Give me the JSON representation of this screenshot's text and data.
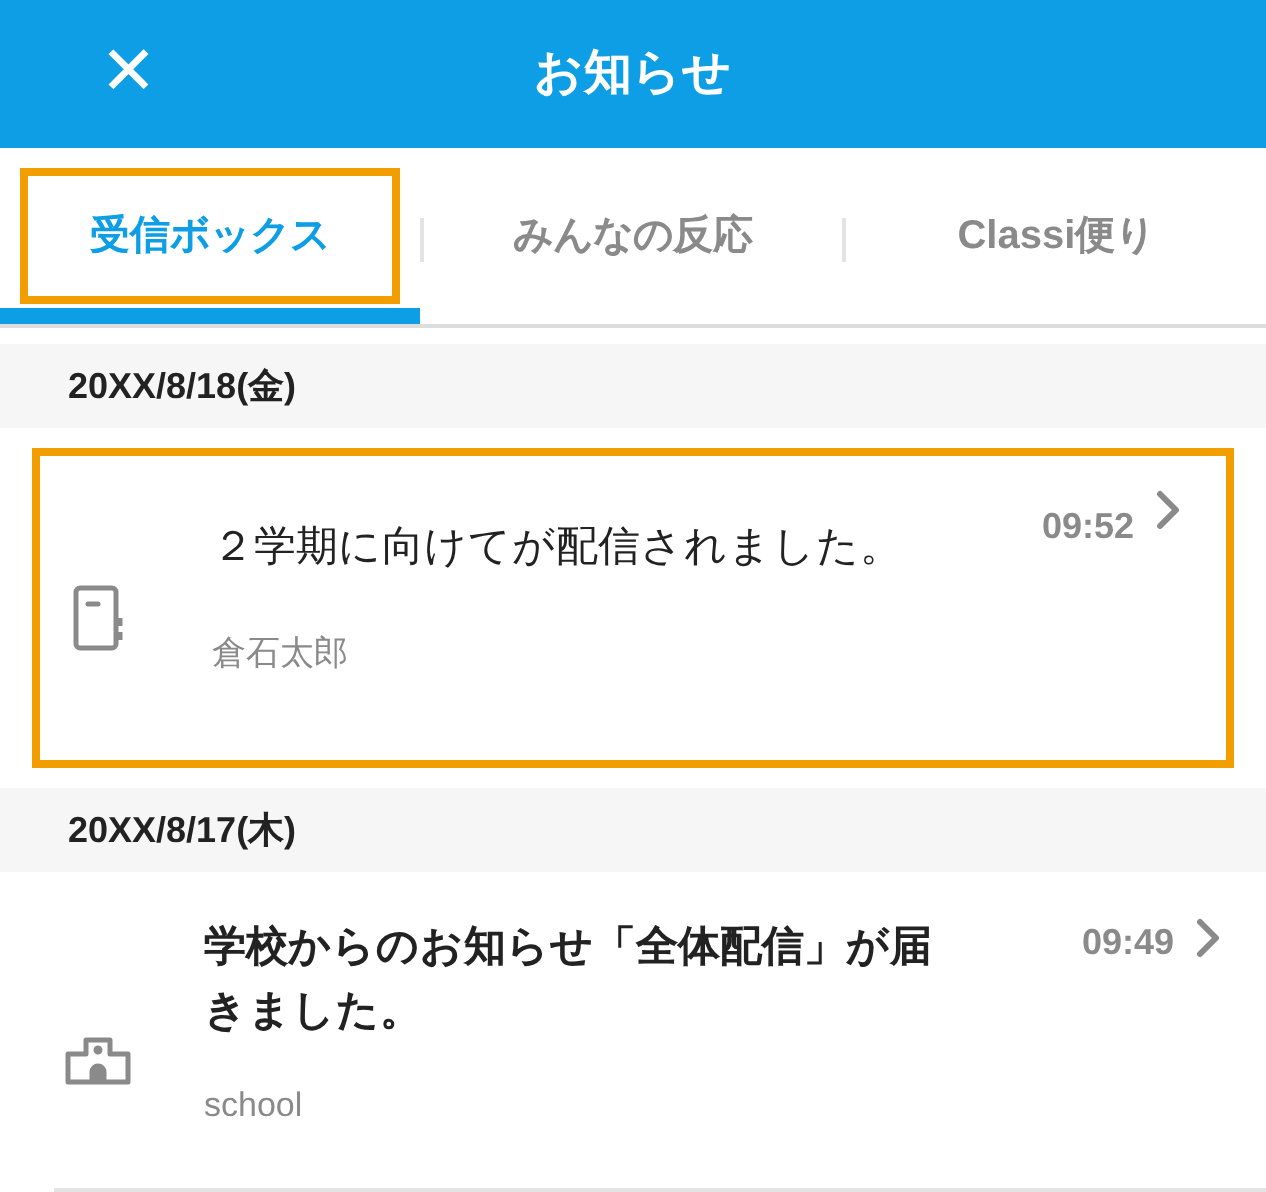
{
  "header": {
    "close": "✕",
    "title": "お知らせ"
  },
  "tabs": [
    {
      "label": "受信ボックス",
      "selected": true,
      "highlighted": true
    },
    {
      "label": "みんなの反応",
      "selected": false,
      "highlighted": false
    },
    {
      "label": "Classi便り",
      "selected": false,
      "highlighted": false
    }
  ],
  "groups": [
    {
      "date": "20XX/8/18(金)",
      "messages": [
        {
          "kind": "notebook",
          "title": "２学期に向けてが配信されました。",
          "sender": "倉石太郎",
          "time": "09:52",
          "highlighted": true,
          "bold": false
        }
      ]
    },
    {
      "date": "20XX/8/17(木)",
      "messages": [
        {
          "kind": "school",
          "title": "学校からのお知らせ「全体配信」が届きました。",
          "sender": "school",
          "time": "09:49",
          "highlighted": false,
          "bold": true
        }
      ]
    }
  ]
}
